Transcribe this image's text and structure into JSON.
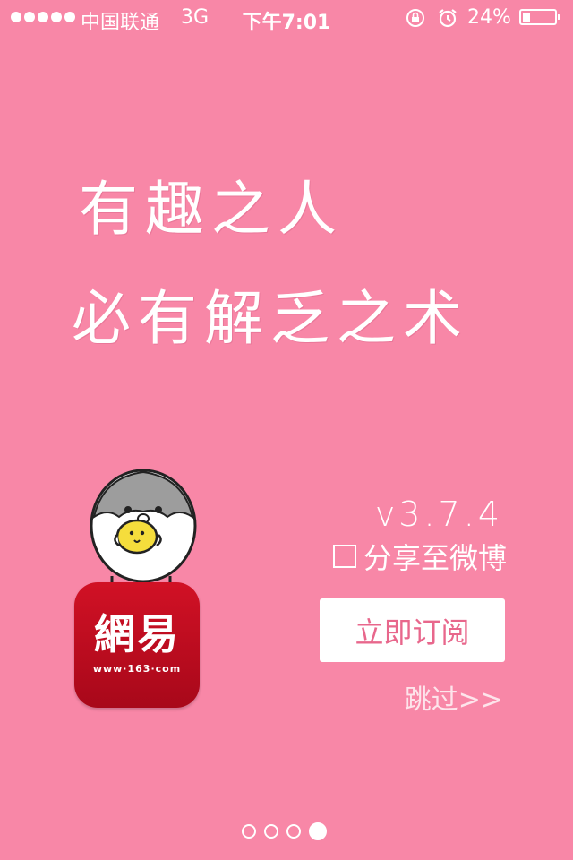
{
  "status_bar": {
    "carrier": "中国联通",
    "network": "3G",
    "time": "下午7:01",
    "battery_percent": "24%",
    "battery_level": 0.24,
    "icons": [
      "signal-dots",
      "orientation-lock-icon",
      "alarm-icon",
      "battery-icon"
    ]
  },
  "slogan": {
    "line1": "有趣之人",
    "line2": "必有解乏之术"
  },
  "logo": {
    "text": "網易",
    "url": "www·163·com"
  },
  "version": "v3.7.4",
  "share": {
    "label": "分享至微博",
    "checked": false
  },
  "subscribe_button": "立即订阅",
  "skip_link": "跳过>>",
  "pager": {
    "count": 4,
    "active": 4
  },
  "colors": {
    "background": "#f887a7",
    "button_text": "#e8678c",
    "logo_red": "#c80e22"
  }
}
